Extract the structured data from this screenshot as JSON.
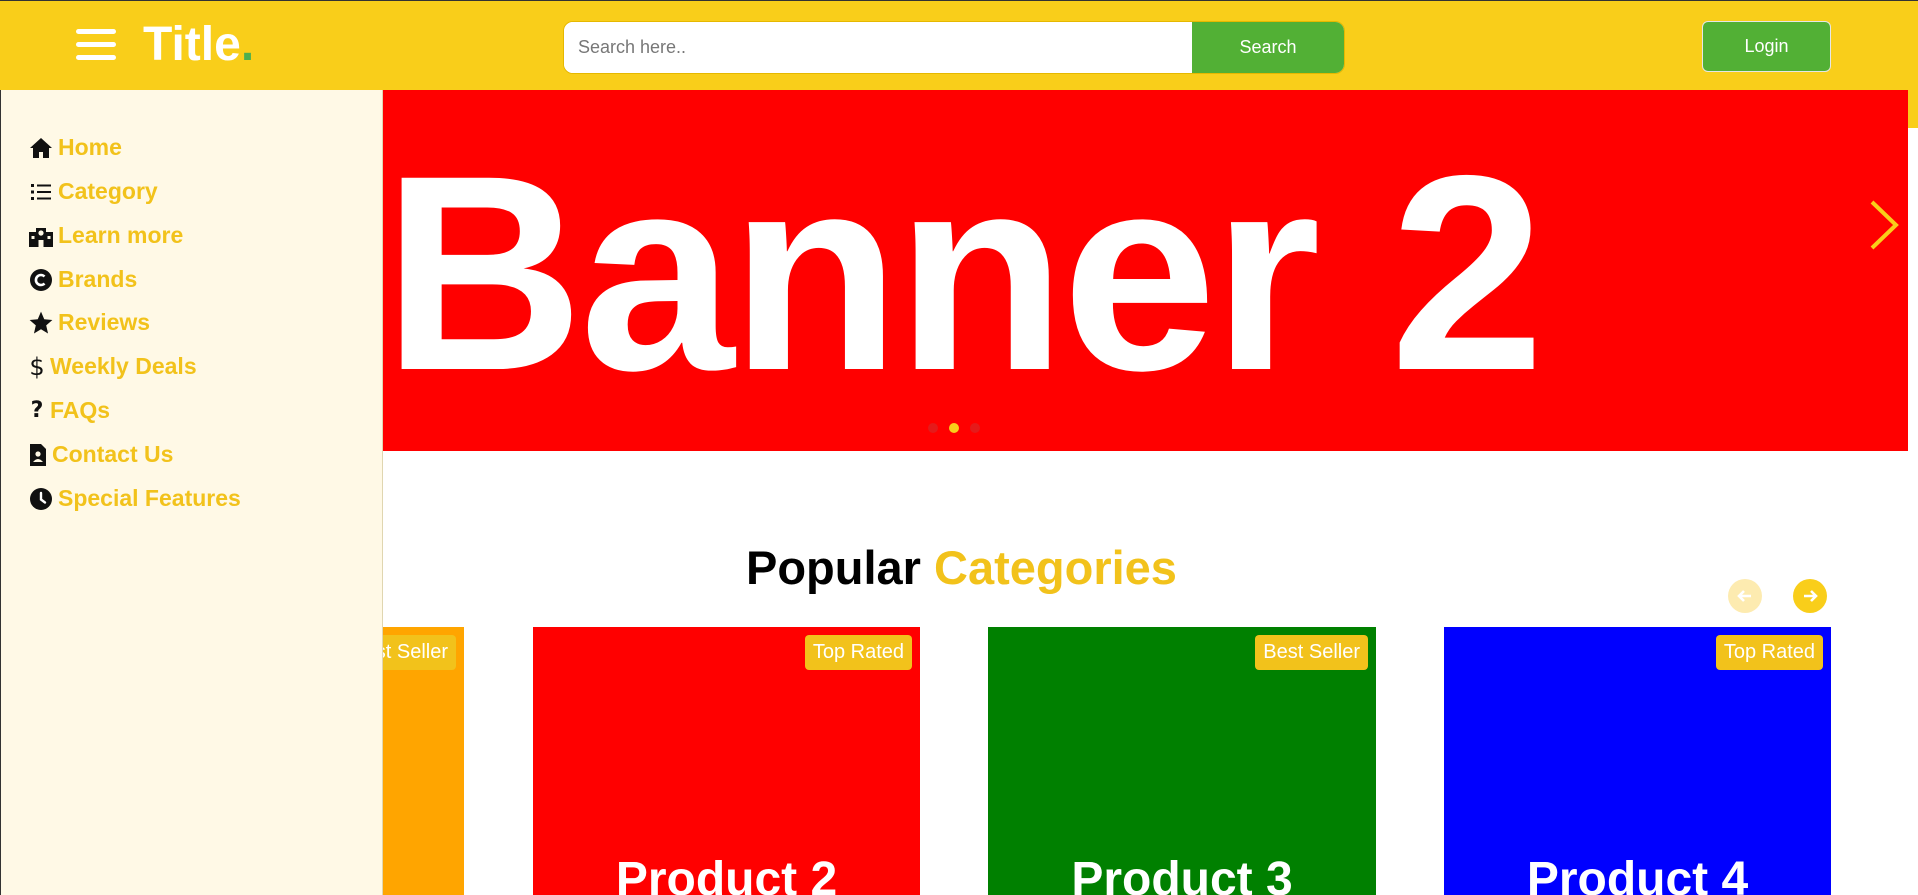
{
  "header": {
    "logo_text": "Title",
    "logo_dot": ".",
    "search_placeholder": "Search here..",
    "search_button": "Search",
    "login_button": "Login"
  },
  "sidebar": {
    "items": [
      {
        "label": "Home",
        "icon": "home-icon"
      },
      {
        "label": "Category",
        "icon": "list-icon"
      },
      {
        "label": "Learn more",
        "icon": "school-icon"
      },
      {
        "label": "Brands",
        "icon": "copyright-icon"
      },
      {
        "label": "Reviews",
        "icon": "star-icon"
      },
      {
        "label": "Weekly Deals",
        "icon": "dollar-icon"
      },
      {
        "label": "FAQs",
        "icon": "question-icon"
      },
      {
        "label": "Contact Us",
        "icon": "contact-file-icon"
      },
      {
        "label": "Special Features",
        "icon": "clock-icon"
      }
    ]
  },
  "banner": {
    "text": "Banner 2",
    "slides_count": 3,
    "active_slide": 2
  },
  "popular": {
    "title_part1": "Popular",
    "title_part2": "Categories"
  },
  "products": [
    {
      "name": "",
      "badge": "Best Seller",
      "color": "#ffa500"
    },
    {
      "name": "Product 2",
      "badge": "Top Rated",
      "color": "#ff0000"
    },
    {
      "name": "Product 3",
      "badge": "Best Seller",
      "color": "#008000"
    },
    {
      "name": "Product 4",
      "badge": "Top Rated",
      "color": "#0000ff"
    }
  ],
  "colors": {
    "header_bg": "#f9ce1a",
    "accent_green": "#52b035",
    "accent_yellow": "#f2c21b",
    "sidebar_bg": "#fff9e6",
    "banner_bg": "#ff0000"
  }
}
